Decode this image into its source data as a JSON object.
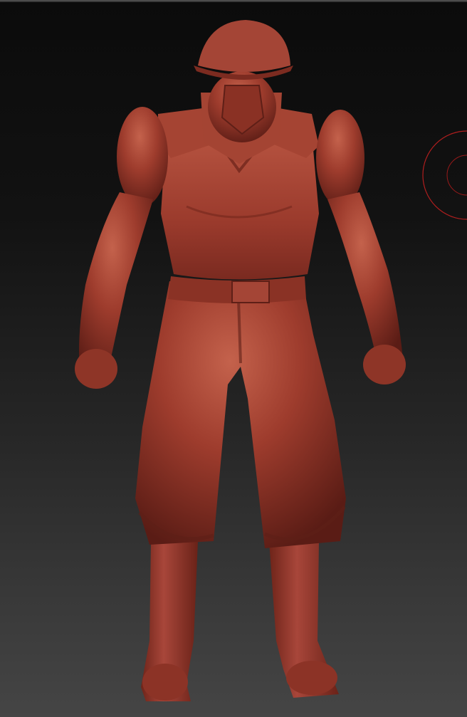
{
  "viewport": {
    "background_top": "#0b0b0b",
    "background_bottom": "#454545",
    "model_material_color": "#9a3a2c",
    "model_highlight_color": "#c0604c",
    "model_shadow_color": "#5e1f17",
    "gizmo_color": "#c02020"
  },
  "model": {
    "subject": "sculpted-soldier-figure",
    "material": "red-wax"
  }
}
